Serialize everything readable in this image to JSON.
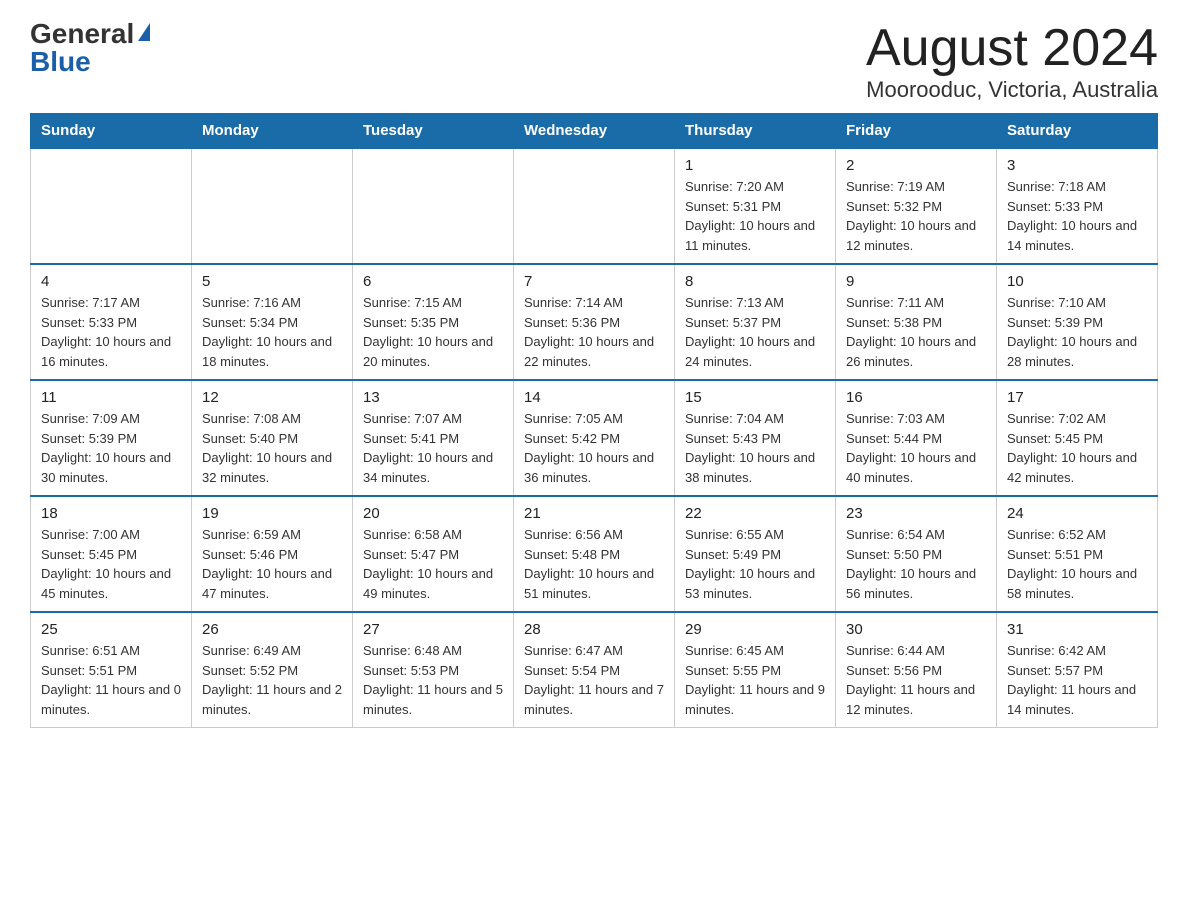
{
  "logo": {
    "general": "General",
    "blue": "Blue"
  },
  "title": "August 2024",
  "subtitle": "Moorooduc, Victoria, Australia",
  "days_of_week": [
    "Sunday",
    "Monday",
    "Tuesday",
    "Wednesday",
    "Thursday",
    "Friday",
    "Saturday"
  ],
  "weeks": [
    [
      {
        "day": "",
        "sunrise": "",
        "sunset": "",
        "daylight": ""
      },
      {
        "day": "",
        "sunrise": "",
        "sunset": "",
        "daylight": ""
      },
      {
        "day": "",
        "sunrise": "",
        "sunset": "",
        "daylight": ""
      },
      {
        "day": "",
        "sunrise": "",
        "sunset": "",
        "daylight": ""
      },
      {
        "day": "1",
        "sunrise": "Sunrise: 7:20 AM",
        "sunset": "Sunset: 5:31 PM",
        "daylight": "Daylight: 10 hours and 11 minutes."
      },
      {
        "day": "2",
        "sunrise": "Sunrise: 7:19 AM",
        "sunset": "Sunset: 5:32 PM",
        "daylight": "Daylight: 10 hours and 12 minutes."
      },
      {
        "day": "3",
        "sunrise": "Sunrise: 7:18 AM",
        "sunset": "Sunset: 5:33 PM",
        "daylight": "Daylight: 10 hours and 14 minutes."
      }
    ],
    [
      {
        "day": "4",
        "sunrise": "Sunrise: 7:17 AM",
        "sunset": "Sunset: 5:33 PM",
        "daylight": "Daylight: 10 hours and 16 minutes."
      },
      {
        "day": "5",
        "sunrise": "Sunrise: 7:16 AM",
        "sunset": "Sunset: 5:34 PM",
        "daylight": "Daylight: 10 hours and 18 minutes."
      },
      {
        "day": "6",
        "sunrise": "Sunrise: 7:15 AM",
        "sunset": "Sunset: 5:35 PM",
        "daylight": "Daylight: 10 hours and 20 minutes."
      },
      {
        "day": "7",
        "sunrise": "Sunrise: 7:14 AM",
        "sunset": "Sunset: 5:36 PM",
        "daylight": "Daylight: 10 hours and 22 minutes."
      },
      {
        "day": "8",
        "sunrise": "Sunrise: 7:13 AM",
        "sunset": "Sunset: 5:37 PM",
        "daylight": "Daylight: 10 hours and 24 minutes."
      },
      {
        "day": "9",
        "sunrise": "Sunrise: 7:11 AM",
        "sunset": "Sunset: 5:38 PM",
        "daylight": "Daylight: 10 hours and 26 minutes."
      },
      {
        "day": "10",
        "sunrise": "Sunrise: 7:10 AM",
        "sunset": "Sunset: 5:39 PM",
        "daylight": "Daylight: 10 hours and 28 minutes."
      }
    ],
    [
      {
        "day": "11",
        "sunrise": "Sunrise: 7:09 AM",
        "sunset": "Sunset: 5:39 PM",
        "daylight": "Daylight: 10 hours and 30 minutes."
      },
      {
        "day": "12",
        "sunrise": "Sunrise: 7:08 AM",
        "sunset": "Sunset: 5:40 PM",
        "daylight": "Daylight: 10 hours and 32 minutes."
      },
      {
        "day": "13",
        "sunrise": "Sunrise: 7:07 AM",
        "sunset": "Sunset: 5:41 PM",
        "daylight": "Daylight: 10 hours and 34 minutes."
      },
      {
        "day": "14",
        "sunrise": "Sunrise: 7:05 AM",
        "sunset": "Sunset: 5:42 PM",
        "daylight": "Daylight: 10 hours and 36 minutes."
      },
      {
        "day": "15",
        "sunrise": "Sunrise: 7:04 AM",
        "sunset": "Sunset: 5:43 PM",
        "daylight": "Daylight: 10 hours and 38 minutes."
      },
      {
        "day": "16",
        "sunrise": "Sunrise: 7:03 AM",
        "sunset": "Sunset: 5:44 PM",
        "daylight": "Daylight: 10 hours and 40 minutes."
      },
      {
        "day": "17",
        "sunrise": "Sunrise: 7:02 AM",
        "sunset": "Sunset: 5:45 PM",
        "daylight": "Daylight: 10 hours and 42 minutes."
      }
    ],
    [
      {
        "day": "18",
        "sunrise": "Sunrise: 7:00 AM",
        "sunset": "Sunset: 5:45 PM",
        "daylight": "Daylight: 10 hours and 45 minutes."
      },
      {
        "day": "19",
        "sunrise": "Sunrise: 6:59 AM",
        "sunset": "Sunset: 5:46 PM",
        "daylight": "Daylight: 10 hours and 47 minutes."
      },
      {
        "day": "20",
        "sunrise": "Sunrise: 6:58 AM",
        "sunset": "Sunset: 5:47 PM",
        "daylight": "Daylight: 10 hours and 49 minutes."
      },
      {
        "day": "21",
        "sunrise": "Sunrise: 6:56 AM",
        "sunset": "Sunset: 5:48 PM",
        "daylight": "Daylight: 10 hours and 51 minutes."
      },
      {
        "day": "22",
        "sunrise": "Sunrise: 6:55 AM",
        "sunset": "Sunset: 5:49 PM",
        "daylight": "Daylight: 10 hours and 53 minutes."
      },
      {
        "day": "23",
        "sunrise": "Sunrise: 6:54 AM",
        "sunset": "Sunset: 5:50 PM",
        "daylight": "Daylight: 10 hours and 56 minutes."
      },
      {
        "day": "24",
        "sunrise": "Sunrise: 6:52 AM",
        "sunset": "Sunset: 5:51 PM",
        "daylight": "Daylight: 10 hours and 58 minutes."
      }
    ],
    [
      {
        "day": "25",
        "sunrise": "Sunrise: 6:51 AM",
        "sunset": "Sunset: 5:51 PM",
        "daylight": "Daylight: 11 hours and 0 minutes."
      },
      {
        "day": "26",
        "sunrise": "Sunrise: 6:49 AM",
        "sunset": "Sunset: 5:52 PM",
        "daylight": "Daylight: 11 hours and 2 minutes."
      },
      {
        "day": "27",
        "sunrise": "Sunrise: 6:48 AM",
        "sunset": "Sunset: 5:53 PM",
        "daylight": "Daylight: 11 hours and 5 minutes."
      },
      {
        "day": "28",
        "sunrise": "Sunrise: 6:47 AM",
        "sunset": "Sunset: 5:54 PM",
        "daylight": "Daylight: 11 hours and 7 minutes."
      },
      {
        "day": "29",
        "sunrise": "Sunrise: 6:45 AM",
        "sunset": "Sunset: 5:55 PM",
        "daylight": "Daylight: 11 hours and 9 minutes."
      },
      {
        "day": "30",
        "sunrise": "Sunrise: 6:44 AM",
        "sunset": "Sunset: 5:56 PM",
        "daylight": "Daylight: 11 hours and 12 minutes."
      },
      {
        "day": "31",
        "sunrise": "Sunrise: 6:42 AM",
        "sunset": "Sunset: 5:57 PM",
        "daylight": "Daylight: 11 hours and 14 minutes."
      }
    ]
  ]
}
